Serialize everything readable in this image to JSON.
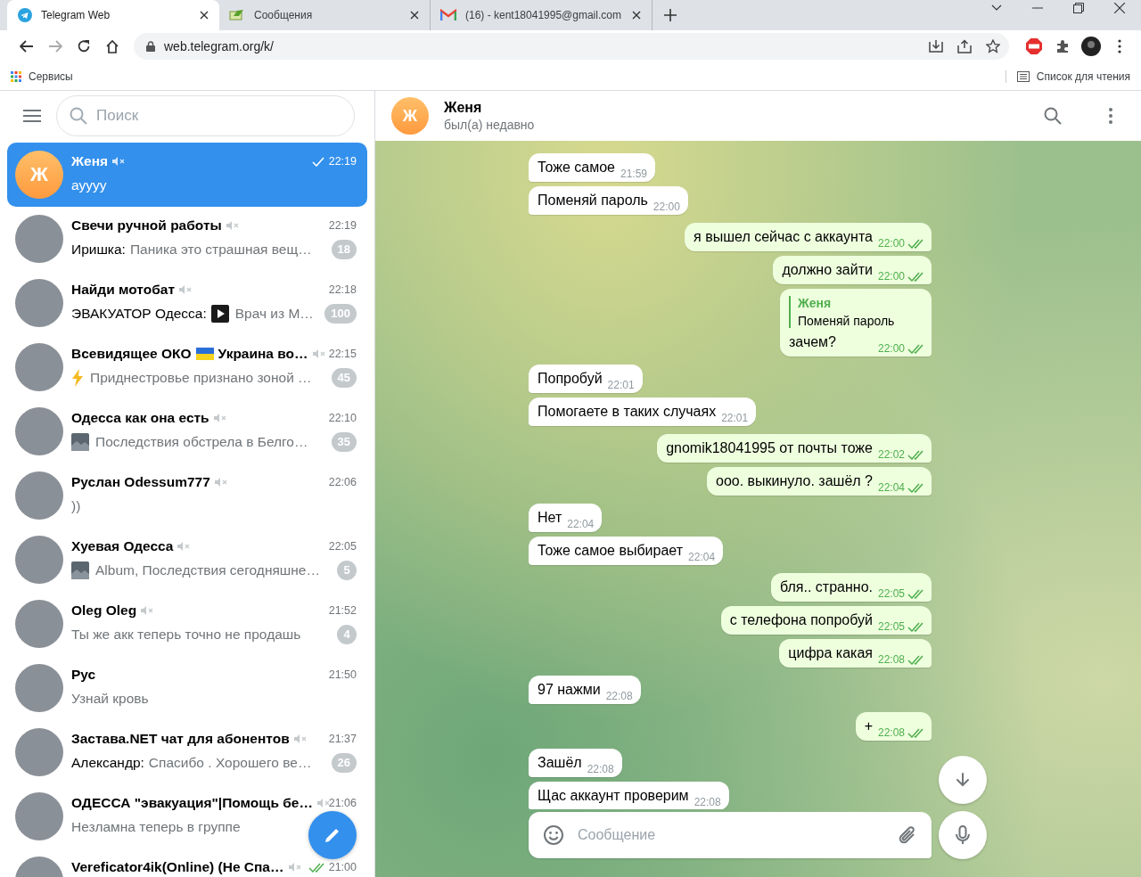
{
  "browser": {
    "tabs": [
      {
        "title": "Telegram Web",
        "kind": "telegram",
        "selected": true
      },
      {
        "title": "Сообщения",
        "kind": "messages",
        "selected": false
      },
      {
        "title": "(16) - kent18041995@gmail.com",
        "kind": "gmail",
        "selected": false
      }
    ],
    "url": "web.telegram.org/k/",
    "bookmarks": [
      {
        "label": "Сервисы"
      }
    ],
    "reading_list": "Список для чтения"
  },
  "sidebar": {
    "search": {
      "placeholder": "Поиск"
    },
    "chats": [
      {
        "avatar": {
          "kind": "letter",
          "letter": "Ж"
        },
        "name": "Женя",
        "muted": true,
        "read": false,
        "time": "22:19",
        "preview": "ayyyy",
        "selected": true
      },
      {
        "avatar": {
          "kind": "photo"
        },
        "name": "Свечи ручной работы",
        "muted": true,
        "time": "22:19",
        "sender": "Иришка:",
        "preview": "Паника это страшная вещ…",
        "unread": "18",
        "selected": false
      },
      {
        "avatar": {
          "kind": "photo"
        },
        "name": "Найди мотобат",
        "muted": true,
        "time": "22:18",
        "sender": "ЭВАКУАТОР Одесса:",
        "media": {
          "kind": "video"
        },
        "preview": "Врач из М…",
        "unread": "100",
        "selected": false
      },
      {
        "avatar": {
          "kind": "photo"
        },
        "name": "Всевидящее ОКО",
        "name_flag": true,
        "name_rest": "Украина во…",
        "muted": true,
        "time": "22:15",
        "media": {
          "kind": "lightning"
        },
        "preview": "Приднестровье признано зоной …",
        "unread": "45",
        "selected": false
      },
      {
        "avatar": {
          "kind": "photo"
        },
        "name": "Одесса как она есть",
        "muted": true,
        "time": "22:10",
        "media": {
          "kind": "photo"
        },
        "preview": "Последствия обстрела в Белго…",
        "unread": "35",
        "selected": false
      },
      {
        "avatar": {
          "kind": "photo"
        },
        "name": "Руслан Odessum777",
        "muted": true,
        "time": "22:06",
        "preview": "))",
        "selected": false
      },
      {
        "avatar": {
          "kind": "photo"
        },
        "name": "Хуевая Одесса",
        "muted": true,
        "time": "22:05",
        "media": {
          "kind": "photo"
        },
        "preview": "Album, Последствия сегодняшне…",
        "unread": "5",
        "selected": false
      },
      {
        "avatar": {
          "kind": "photo"
        },
        "name": "Oleg Oleg",
        "muted": true,
        "time": "21:52",
        "preview": "Ты же акк теперь точно не продашь",
        "unread": "4",
        "selected": false
      },
      {
        "avatar": {
          "kind": "photo"
        },
        "name": "Рус",
        "muted": false,
        "time": "21:50",
        "preview": "Узнай кровь",
        "selected": false
      },
      {
        "avatar": {
          "kind": "photo"
        },
        "name": "Застава.NET чат для абонентов",
        "muted": true,
        "time": "21:37",
        "sender": "Александр:",
        "preview": "Спасибо . Хорошего ве…",
        "unread": "26",
        "selected": false
      },
      {
        "avatar": {
          "kind": "photo"
        },
        "name": "ОДЕССА \"эвакуация\"|Помощь бе…",
        "muted": true,
        "time": "21:06",
        "preview": "Незламна теперь в группе",
        "selected": false
      },
      {
        "avatar": {
          "kind": "photo"
        },
        "name": "Vereficator4ik(Online) (Не Спа…",
        "muted": true,
        "read": true,
        "time": "21:00",
        "selected": false
      }
    ]
  },
  "chat": {
    "header": {
      "avatar_letter": "Ж",
      "name": "Женя",
      "status": "был(а) недавно"
    },
    "messages": [
      {
        "outgoing": false,
        "text": "Тоже самое",
        "time": "21:59"
      },
      {
        "outgoing": false,
        "text": "Поменяй пароль",
        "time": "22:00"
      },
      {
        "outgoing": true,
        "text": "я вышел сейчас с аккаунта",
        "time": "22:00",
        "read": true
      },
      {
        "outgoing": true,
        "text": "должно зайти",
        "time": "22:00",
        "read": true
      },
      {
        "outgoing": true,
        "reply": {
          "name": "Женя",
          "text": "Поменяй пароль"
        },
        "text": "зачем?",
        "time": "22:00",
        "read": true
      },
      {
        "outgoing": false,
        "text": "Попробуй",
        "time": "22:01"
      },
      {
        "outgoing": false,
        "text": "Помогаете в таких случаях",
        "time": "22:01"
      },
      {
        "outgoing": true,
        "text": "gnomik18041995 от почты тоже",
        "time": "22:02",
        "read": true
      },
      {
        "outgoing": true,
        "text": "ооо. выкинуло. зашёл ?",
        "time": "22:04",
        "read": true
      },
      {
        "outgoing": false,
        "text": "Нет",
        "time": "22:04"
      },
      {
        "outgoing": false,
        "text": "Тоже самое выбирает",
        "time": "22:04"
      },
      {
        "outgoing": true,
        "text": "бля.. странно.",
        "time": "22:05",
        "read": true
      },
      {
        "outgoing": true,
        "text": "с телефона попробуй",
        "time": "22:05",
        "read": true
      },
      {
        "outgoing": true,
        "text": "цифра какая",
        "time": "22:08",
        "read": true
      },
      {
        "outgoing": false,
        "text": "97 нажми",
        "time": "22:08"
      },
      {
        "outgoing": true,
        "text": "+",
        "time": "22:08",
        "read": true
      },
      {
        "outgoing": false,
        "text": "Зашёл",
        "time": "22:08"
      },
      {
        "outgoing": false,
        "text": "Щас аккаунт проверим",
        "time": "22:08"
      }
    ],
    "composer": {
      "placeholder": "Сообщение"
    }
  }
}
